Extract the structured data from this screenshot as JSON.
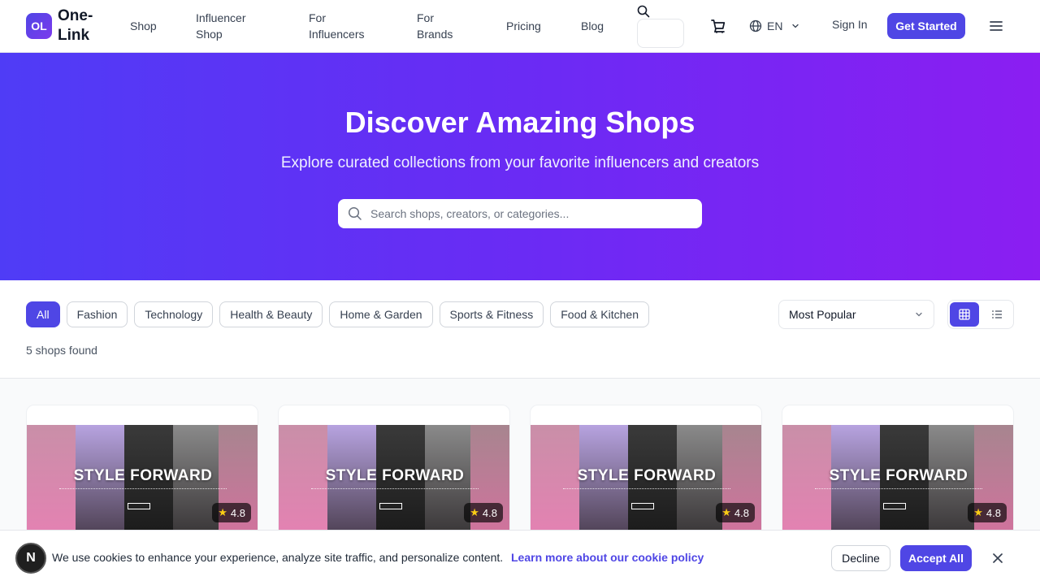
{
  "brand": {
    "badge": "OL",
    "name": "One-Link"
  },
  "nav": {
    "links": [
      "Shop",
      "Influencer Shop",
      "For Influencers",
      "For Brands",
      "Pricing",
      "Blog"
    ],
    "language": "EN",
    "sign_in": "Sign In",
    "get_started": "Get Started"
  },
  "hero": {
    "title": "Discover Amazing Shops",
    "subtitle": "Explore curated collections from your favorite influencers and creators",
    "search_placeholder": "Search shops, creators, or categories..."
  },
  "filters": {
    "categories": [
      "All",
      "Fashion",
      "Technology",
      "Health & Beauty",
      "Home & Garden",
      "Sports & Fitness",
      "Food & Kitchen"
    ],
    "active_category": "All",
    "result_count": "5 shops found",
    "sort_selected": "Most Popular",
    "view_mode": "grid"
  },
  "shops": [
    {
      "banner": "STYLE FORWARD",
      "rating": "4.8"
    },
    {
      "banner": "STYLE FORWARD",
      "rating": "4.8"
    },
    {
      "banner": "STYLE FORWARD",
      "rating": "4.8"
    },
    {
      "banner": "STYLE FORWARD",
      "rating": "4.8"
    }
  ],
  "cookie": {
    "badge": "N",
    "message": "We use cookies to enhance your experience, analyze site traffic, and personalize content.",
    "link": "Learn more about our cookie policy",
    "decline": "Decline",
    "accept": "Accept All"
  },
  "colors": {
    "primary": "#4f46e5",
    "hero_start": "#4f3cf6",
    "hero_end": "#8b1ef2",
    "star": "#facc15"
  }
}
